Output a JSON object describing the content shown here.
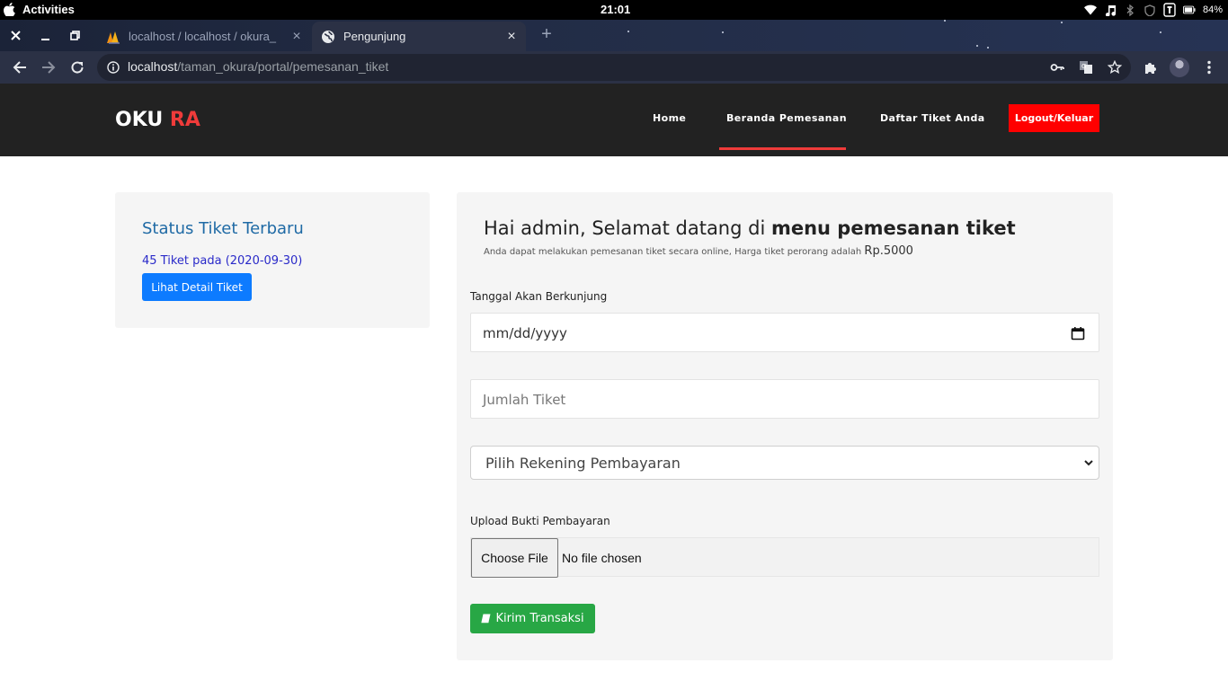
{
  "os": {
    "activities": "Activities",
    "clock": "21:01",
    "battery": "84%"
  },
  "browser": {
    "tabs": [
      {
        "title": "localhost / localhost / okura_",
        "active": false
      },
      {
        "title": "Pengunjung",
        "active": true
      }
    ],
    "url_host": "localhost",
    "url_path": "/taman_okura/portal/pemesanan_tiket"
  },
  "header": {
    "logo_part1": "OKU",
    "logo_part2": "RA",
    "nav": [
      "Home",
      "Beranda Pemesanan",
      "Daftar Tiket Anda"
    ],
    "logout": "Logout/Keluar",
    "accent_color": "#ef3b3a"
  },
  "status_card": {
    "title": "Status Tiket Terbaru",
    "info": "45 Tiket pada (2020-09-30)",
    "button": "Lihat Detail Tiket"
  },
  "form": {
    "heading_prefix": "Hai admin, Selamat datang di ",
    "heading_bold": "menu pemesanan tiket",
    "subtitle": "Anda dapat melakukan pemesanan tiket secara online, Harga tiket perorang adalah ",
    "price": "Rp.5000",
    "date_label": "Tanggal Akan Berkunjung",
    "date_placeholder": "mm/dd/yyyy",
    "qty_placeholder": "Jumlah Tiket",
    "account_select": "Pilih Rekening Pembayaran",
    "upload_label": "Upload Bukti Pembayaran",
    "choose_file": "Choose File",
    "no_file": "No file chosen",
    "submit": "Kirim Transaksi"
  }
}
